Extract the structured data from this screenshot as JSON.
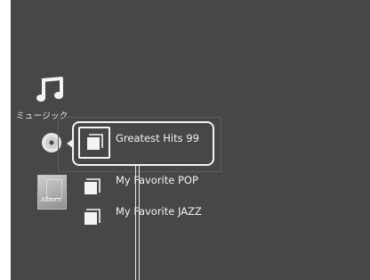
{
  "category": {
    "label": "ミュージック",
    "icon": "music-note-icon"
  },
  "current_source": {
    "icon": "disc-icon"
  },
  "playlists": [
    {
      "label": "Greatest Hits 99",
      "selected": true,
      "icon": "playlist-icon"
    },
    {
      "label": "My Favorite POP",
      "selected": false,
      "icon": "playlist-icon"
    },
    {
      "label": "My Favorite JAZZ",
      "selected": false,
      "icon": "playlist-icon"
    }
  ],
  "thumbnail": {
    "label": "Album"
  },
  "colors": {
    "background": "#474747",
    "foreground": "#f4f4f4"
  }
}
